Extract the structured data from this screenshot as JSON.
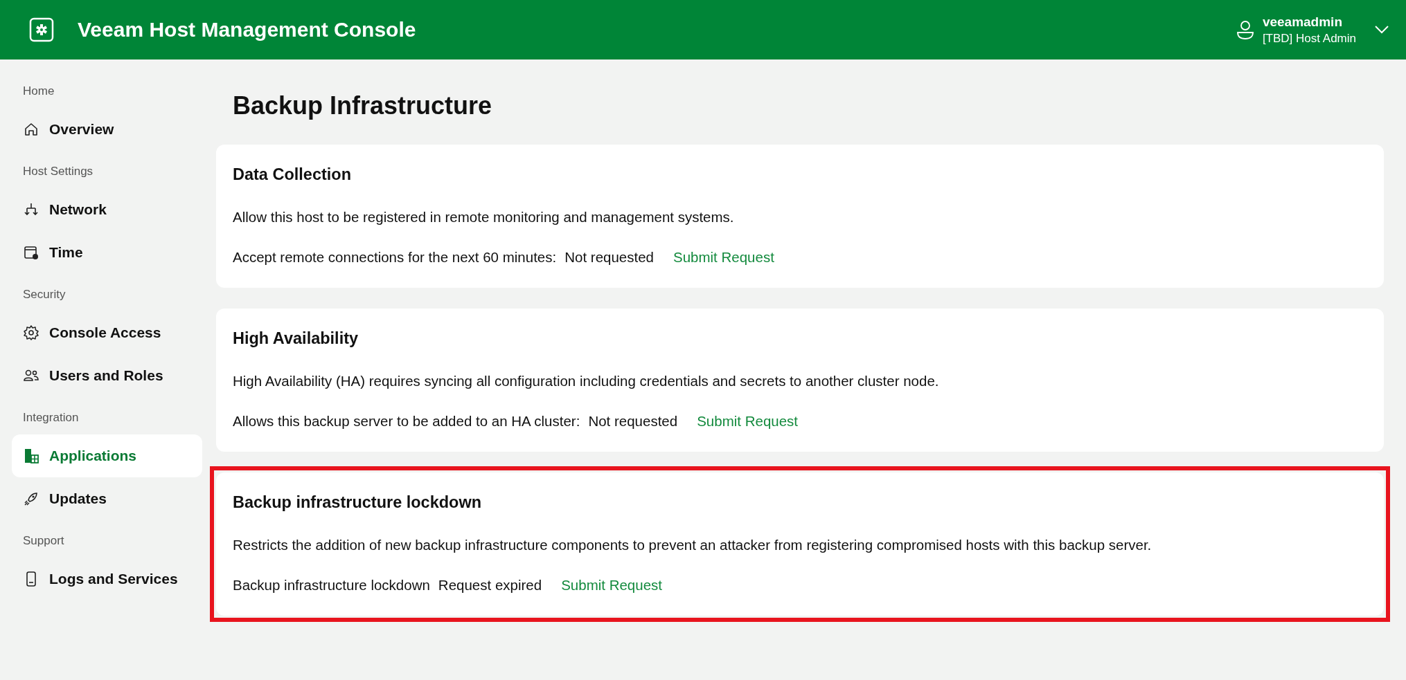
{
  "header": {
    "title": "Veeam Host Management Console",
    "user": {
      "name": "veeamadmin",
      "role": "[TBD] Host Admin"
    }
  },
  "sidebar": {
    "groups": [
      {
        "label": "Home",
        "items": [
          {
            "label": "Overview",
            "selected": false
          }
        ]
      },
      {
        "label": "Host Settings",
        "items": [
          {
            "label": "Network",
            "selected": false
          },
          {
            "label": "Time",
            "selected": false
          }
        ]
      },
      {
        "label": "Security",
        "items": [
          {
            "label": "Console Access",
            "selected": false
          },
          {
            "label": "Users and Roles",
            "selected": false
          }
        ]
      },
      {
        "label": "Integration",
        "items": [
          {
            "label": "Applications",
            "selected": true
          },
          {
            "label": "Updates",
            "selected": false
          }
        ]
      },
      {
        "label": "Support",
        "items": [
          {
            "label": "Logs and Services",
            "selected": false
          }
        ]
      }
    ]
  },
  "page": {
    "title": "Backup Infrastructure",
    "cards": [
      {
        "title": "Data Collection",
        "description": "Allow this host to be registered in remote monitoring and management systems.",
        "setting": "Accept remote connections for the next 60 minutes:",
        "status": "Not requested",
        "action": "Submit Request",
        "highlighted": false
      },
      {
        "title": "High Availability",
        "description": "High Availability (HA) requires syncing all configuration including credentials and secrets to another cluster node.",
        "setting": "Allows this backup server to be added to an HA cluster:",
        "status": "Not requested",
        "action": "Submit Request",
        "highlighted": false
      },
      {
        "title": "Backup infrastructure lockdown",
        "description": "Restricts the addition of new backup infrastructure components to prevent an attacker from registering compromised hosts with this backup server.",
        "setting": "Backup infrastructure lockdown",
        "status": "Request expired",
        "action": "Submit Request",
        "highlighted": true
      }
    ]
  }
}
